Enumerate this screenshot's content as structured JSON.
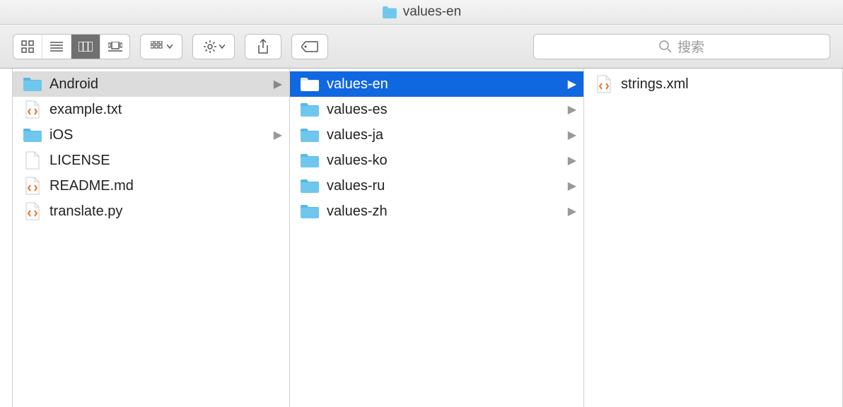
{
  "window": {
    "title": "values-en"
  },
  "search": {
    "placeholder": "搜索"
  },
  "columns": {
    "col1": [
      {
        "name": "Android",
        "type": "folder",
        "selected": "inactive",
        "expandable": true
      },
      {
        "name": "example.txt",
        "type": "code",
        "selected": "none",
        "expandable": false
      },
      {
        "name": "iOS",
        "type": "folder",
        "selected": "none",
        "expandable": true
      },
      {
        "name": "LICENSE",
        "type": "blank",
        "selected": "none",
        "expandable": false
      },
      {
        "name": "README.md",
        "type": "code",
        "selected": "none",
        "expandable": false
      },
      {
        "name": "translate.py",
        "type": "code",
        "selected": "none",
        "expandable": false
      }
    ],
    "col2": [
      {
        "name": "values-en",
        "type": "folder",
        "selected": "active",
        "expandable": true
      },
      {
        "name": "values-es",
        "type": "folder",
        "selected": "none",
        "expandable": true
      },
      {
        "name": "values-ja",
        "type": "folder",
        "selected": "none",
        "expandable": true
      },
      {
        "name": "values-ko",
        "type": "folder",
        "selected": "none",
        "expandable": true
      },
      {
        "name": "values-ru",
        "type": "folder",
        "selected": "none",
        "expandable": true
      },
      {
        "name": "values-zh",
        "type": "folder",
        "selected": "none",
        "expandable": true
      }
    ],
    "col3": [
      {
        "name": "strings.xml",
        "type": "code",
        "selected": "none",
        "expandable": false
      }
    ]
  }
}
